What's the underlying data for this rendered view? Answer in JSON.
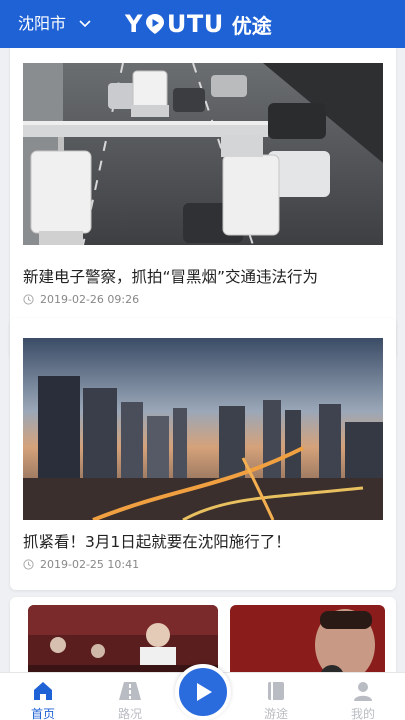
{
  "header": {
    "city": "沈阳市",
    "brand_en_prefix": "Y",
    "brand_en_suffix": "UTU",
    "brand_cn": "优途",
    "color": "#1f62d6"
  },
  "feed": {
    "articles": [
      {
        "title": "新建电子警察，抓拍“冒黑烟”交通违法行为",
        "time": "2019-02-26 09:26",
        "image": "traffic-camera-photo"
      },
      {
        "title": "抓紧看！3月1日起就要在沈阳施行了！",
        "time": "2019-02-25 10:41",
        "image": "city-skyline-photo"
      },
      {
        "image_left": "stage-performer-photo",
        "image_right": "singer-portrait-photo"
      }
    ]
  },
  "tabbar": {
    "items": [
      {
        "label": "首页",
        "icon": "home-icon",
        "active": true
      },
      {
        "label": "路况",
        "icon": "road-icon",
        "active": false
      },
      {
        "label": "",
        "icon": "play-icon",
        "active": false
      },
      {
        "label": "游途",
        "icon": "book-icon",
        "active": false
      },
      {
        "label": "我的",
        "icon": "user-icon",
        "active": false
      }
    ],
    "active_color": "#1f62d6",
    "inactive_color": "#b9bcc2"
  }
}
